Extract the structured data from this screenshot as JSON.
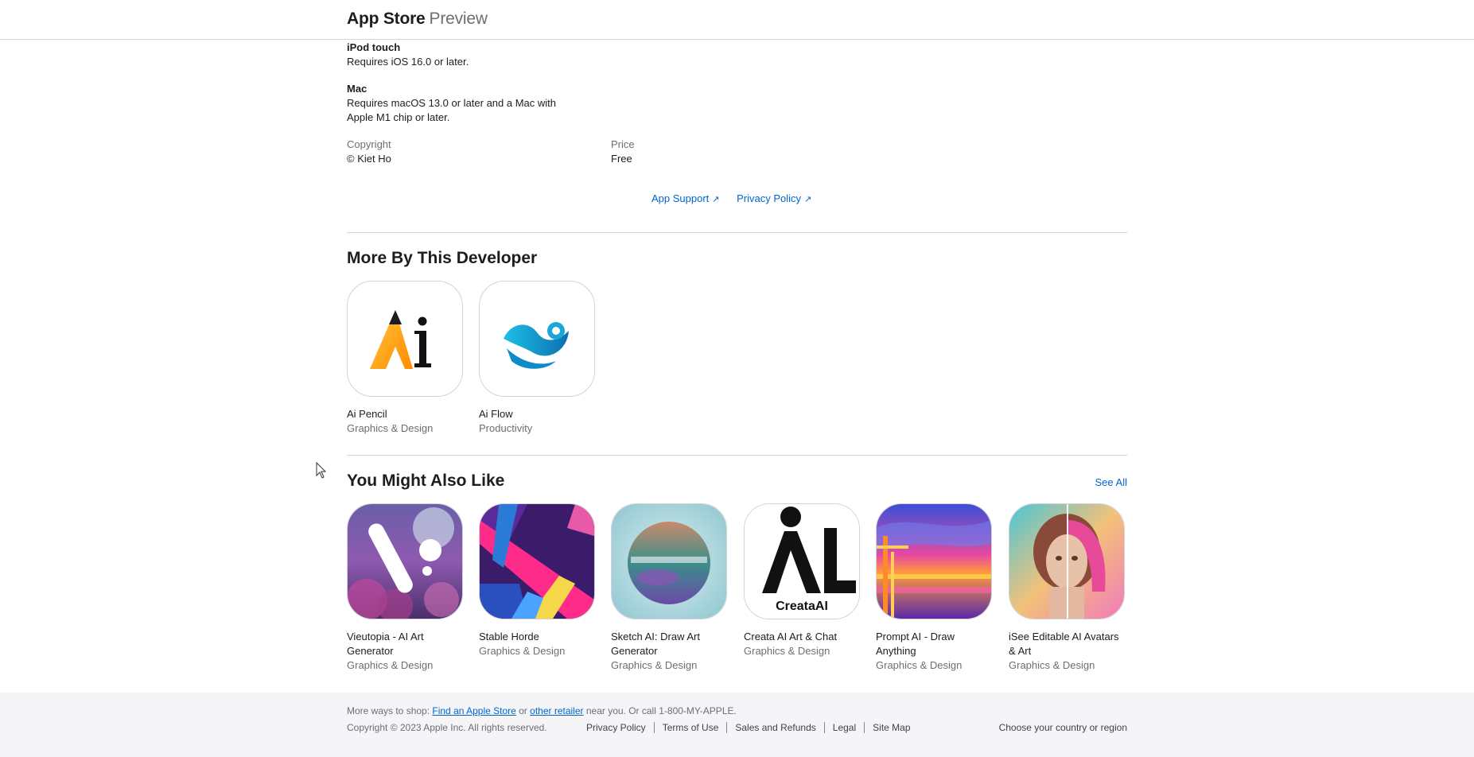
{
  "header": {
    "brand": "App Store",
    "sub": "Preview"
  },
  "compat": {
    "ipod_title": "iPod touch",
    "ipod_req": "Requires iOS 16.0 or later.",
    "mac_title": "Mac",
    "mac_req_1": "Requires macOS 13.0 or later and a Mac with",
    "mac_req_2": "Apple M1 chip or later."
  },
  "info": {
    "copyright_label": "Copyright",
    "copyright_value": "© Kiet Ho",
    "price_label": "Price",
    "price_value": "Free"
  },
  "links": {
    "support": "App Support",
    "privacy": "Privacy Policy",
    "arrow": "↗"
  },
  "more_by": {
    "title": "More By This Developer",
    "apps": [
      {
        "name": "Ai Pencil",
        "category": "Graphics & Design"
      },
      {
        "name": "Ai Flow",
        "category": "Productivity"
      }
    ]
  },
  "also_like": {
    "title": "You Might Also Like",
    "see_all": "See All",
    "apps": [
      {
        "name": "Vieutopia - AI Art",
        "name2": "Generator",
        "category": "Graphics & Design"
      },
      {
        "name": "Stable Horde",
        "name2": "",
        "category": "Graphics & Design"
      },
      {
        "name": "Sketch AI: Draw Art",
        "name2": "Generator",
        "category": "Graphics & Design"
      },
      {
        "name": "Creata AI Art & Chat",
        "name2": "",
        "category": "Graphics & Design",
        "icon_text": "CreataAI"
      },
      {
        "name": "Prompt AI - Draw",
        "name2": "Anything",
        "category": "Graphics & Design"
      },
      {
        "name": "iSee Editable AI Avatars",
        "name2": "& Art",
        "category": "Graphics & Design"
      }
    ]
  },
  "footer": {
    "shop_prefix": "More ways to shop: ",
    "find_store": "Find an Apple Store",
    "or": " or ",
    "other_retailer": "other retailer",
    "shop_suffix": " near you. Or call 1-800-MY-APPLE.",
    "copyright": "Copyright © 2023 Apple Inc. All rights reserved.",
    "links": [
      "Privacy Policy",
      "Terms of Use",
      "Sales and Refunds",
      "Legal",
      "Site Map"
    ],
    "region": "Choose your country or region"
  },
  "colors": {
    "link": "#0066cc",
    "text": "#1d1d1f",
    "secondary": "#6e6e73",
    "footer_bg": "#f5f5f7"
  }
}
